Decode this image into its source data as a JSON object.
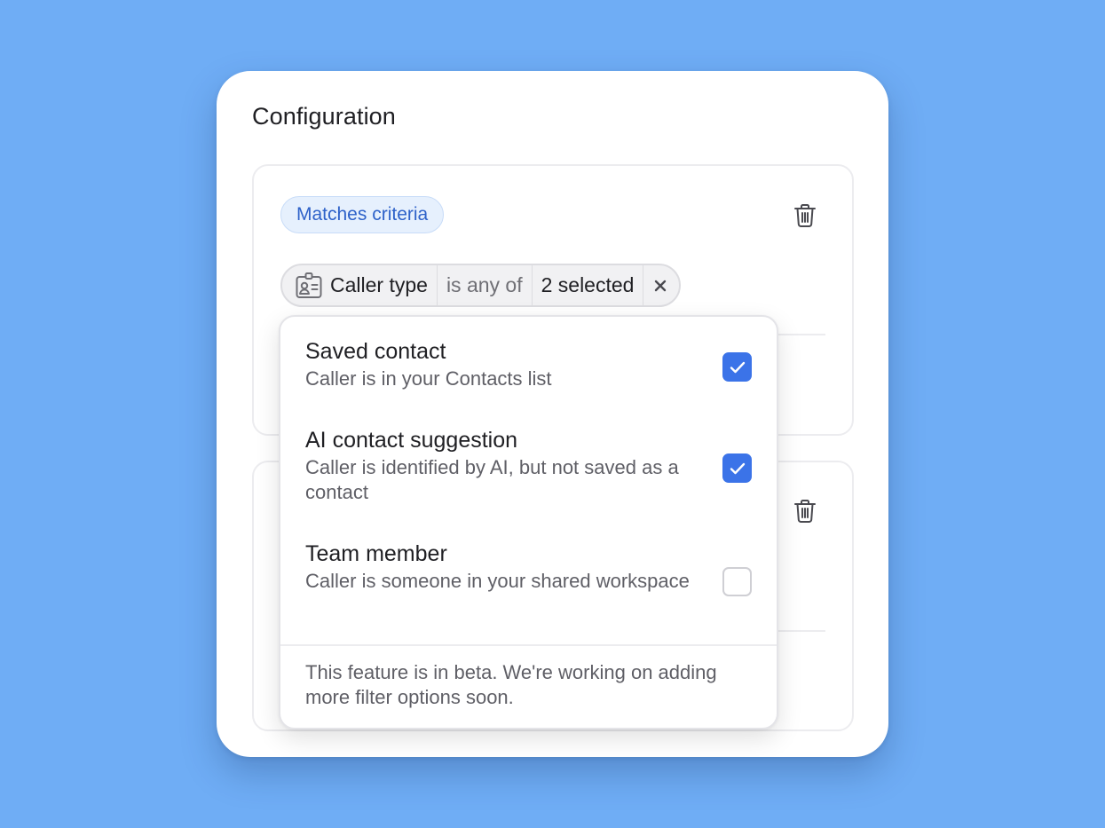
{
  "title": "Configuration",
  "panel1": {
    "badge": "Matches criteria",
    "filter": {
      "field_icon": "contact-card-icon",
      "field": "Caller type",
      "operator": "is any of",
      "value": "2 selected",
      "clear_icon": "close-icon"
    },
    "delete_icon": "trash-icon"
  },
  "panel2": {
    "delete_icon": "trash-icon"
  },
  "dropdown": {
    "options": [
      {
        "title": "Saved contact",
        "description": "Caller is in your Contacts list",
        "checked": true
      },
      {
        "title": "AI contact suggestion",
        "description": "Caller is identified by AI, but not saved as a contact",
        "checked": true
      },
      {
        "title": "Team member",
        "description": "Caller is someone in your shared workspace",
        "checked": false
      }
    ],
    "footer": "This feature is in beta. We're working on adding more filter options soon."
  },
  "colors": {
    "background": "#6fadf5",
    "accent": "#3b73e8",
    "badge_text": "#2e62c9",
    "badge_bg": "#e6f0fd"
  }
}
